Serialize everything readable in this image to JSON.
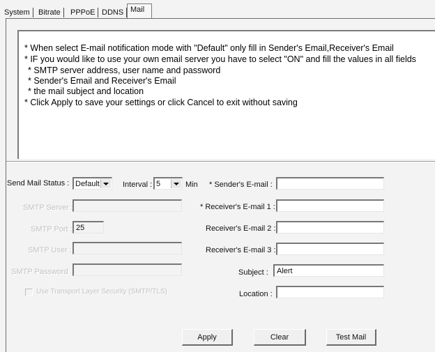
{
  "tabs": [
    {
      "label": "System"
    },
    {
      "label": "Bitrate"
    },
    {
      "label": "PPPoE"
    },
    {
      "label": "DDNS"
    },
    {
      "label": "Mail"
    }
  ],
  "notice": {
    "lines": [
      "* When select E-mail notification mode with \"Default\" only fill in Sender's Email,Receiver's Email",
      "* IF you would like to use your own email server you have to select \"ON\" and fill the values in all fields",
      "* SMTP server address, user name and password",
      "* Sender's Email and Receiver's Email",
      "* the mail subject and location",
      "* Click Apply to save your settings or click Cancel to exit without saving"
    ]
  },
  "form": {
    "send_mail_status_label": "Send Mail Status :",
    "send_mail_status_value": "Default",
    "interval_label": "Interval :",
    "interval_value": "5",
    "interval_unit": "Min",
    "smtp_server_label": "SMTP Server :",
    "smtp_server_value": "",
    "smtp_port_label": "SMTP Port :",
    "smtp_port_value": "25",
    "smtp_user_label": "SMTP User :",
    "smtp_user_value": "",
    "smtp_password_label": "SMTP Password :",
    "smtp_password_value": "",
    "secure_checkbox_label": "Use Transport Layer Security (SMTP/TLS)",
    "sender_email_label": "* Sender's E-mail :",
    "sender_email_value": "",
    "receiver1_label": "* Receiver's E-mail 1 :",
    "receiver1_value": "",
    "receiver2_label": "Receiver's E-mail 2 :",
    "receiver2_value": "",
    "receiver3_label": "Receiver's E-mail 3 :",
    "receiver3_value": "",
    "subject_label": "Subject :",
    "subject_value": "Alert",
    "location_label": "Location :",
    "location_value": ""
  },
  "buttons": {
    "apply": "Apply",
    "clear": "Clear",
    "test_mail": "Test Mail"
  }
}
